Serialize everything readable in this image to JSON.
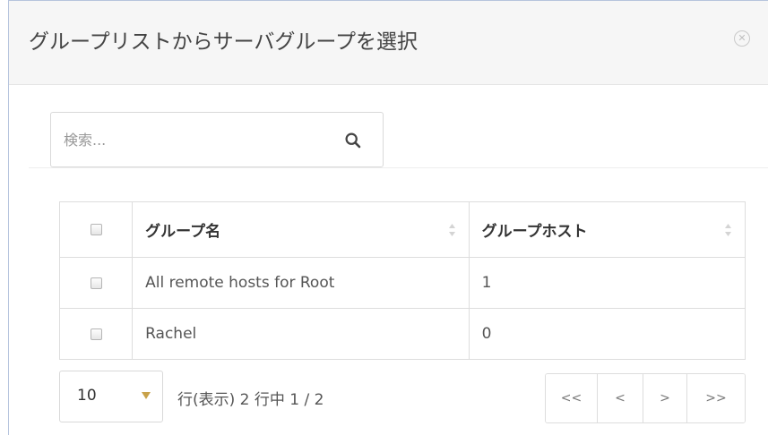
{
  "dialog": {
    "title": "グループリストからサーバグループを選択",
    "close_icon": "close-circle-icon"
  },
  "search": {
    "placeholder": "検索...",
    "value": "",
    "icon": "search-icon"
  },
  "table": {
    "columns": [
      {
        "label": "",
        "type": "checkbox"
      },
      {
        "label": "グループ名",
        "sortable": true
      },
      {
        "label": "グループホスト",
        "sortable": true
      }
    ],
    "rows": [
      {
        "checked": false,
        "name": "All remote hosts for Root",
        "hosts": "1"
      },
      {
        "checked": false,
        "name": "Rachel",
        "hosts": "0"
      }
    ]
  },
  "pagination": {
    "page_size": "10",
    "rows_label": "行(表示)",
    "info": "2 行中 1 / 2",
    "buttons": [
      "<<",
      "<",
      ">",
      ">>"
    ]
  },
  "colors": {
    "header_bg": "#f6f6f6",
    "border": "#dddddd",
    "caret": "#c8a24a",
    "dialog_edge": "#b6c4dd"
  }
}
